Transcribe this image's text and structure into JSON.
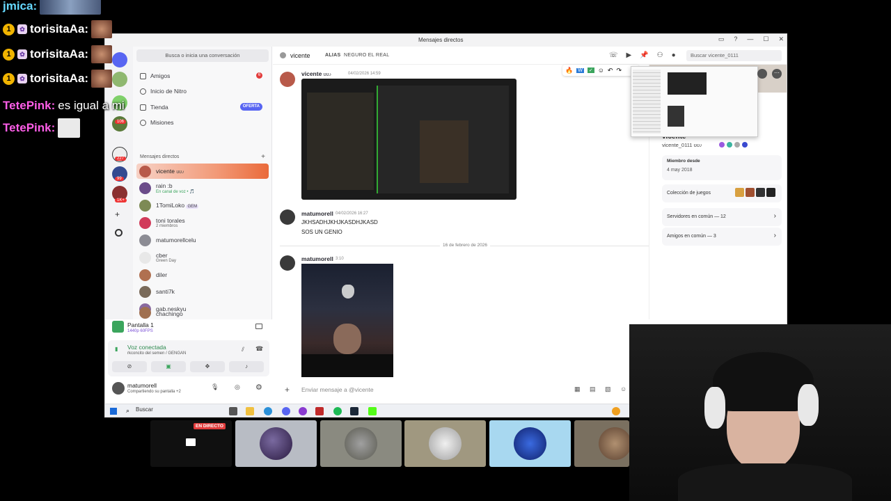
{
  "chat_overlay": [
    {
      "user": "jmica",
      "color": "#66d9ff",
      "text": "",
      "badges": []
    },
    {
      "user": "torisitaAa",
      "color": "#ffffff",
      "text": "",
      "badges": [
        "gold",
        "pink"
      ]
    },
    {
      "user": "torisitaAa",
      "color": "#ffffff",
      "text": "",
      "badges": [
        "gold",
        "pink"
      ]
    },
    {
      "user": "torisitaAa",
      "color": "#ffffff",
      "text": "",
      "badges": [
        "gold",
        "pink"
      ]
    },
    {
      "user": "TetePink",
      "color": "#ff5ee8",
      "text": "es igual a mi",
      "badges": []
    },
    {
      "user": "TetePink",
      "color": "#ff5ee8",
      "text": "",
      "badges": []
    }
  ],
  "window": {
    "title": "Mensajes directos"
  },
  "rail": {
    "badges": [
      "106",
      "227",
      "99",
      "1K+"
    ]
  },
  "sidebar": {
    "search_placeholder": "Busca o inicia una conversación",
    "nav": [
      {
        "label": "Amigos",
        "badge": "6"
      },
      {
        "label": "Inicio de Nitro",
        "badge": ""
      },
      {
        "label": "Tienda",
        "badge": "OFERTA"
      },
      {
        "label": "Misiones",
        "badge": ""
      }
    ],
    "dm_header": "Mensajes directos",
    "dms": [
      {
        "name": "vicente",
        "tag": "ʊʊ♪",
        "sub": "",
        "color": "#b85a4a",
        "active": true
      },
      {
        "name": "rain :b",
        "tag": "",
        "sub": "En canal de voz • 🎵",
        "color": "#6b4c8a"
      },
      {
        "name": "1TomiLoko",
        "tag": "GEM",
        "sub": "",
        "color": "#7d8a55"
      },
      {
        "name": "toni torales",
        "tag": "",
        "sub": "2 miembros",
        "color": "#d13b5a"
      },
      {
        "name": "matumorellcelu",
        "tag": "",
        "sub": "",
        "color": "#8c8c94"
      },
      {
        "name": "cber",
        "tag": "",
        "sub": "Green Day",
        "color": "#e8e8e8"
      },
      {
        "name": "diler",
        "tag": "",
        "sub": "",
        "color": "#b07050"
      },
      {
        "name": "santi7k",
        "tag": "",
        "sub": "",
        "color": "#7a6a5a"
      },
      {
        "name": "gab.neskyu",
        "tag": "",
        "sub": "",
        "color": "#8a6aa0"
      },
      {
        "name": "chachingo",
        "tag": "",
        "sub": "",
        "color": "#a07050"
      }
    ],
    "screen": {
      "title": "Pantalla 1",
      "sub": "1440p 60FPS"
    },
    "voice": {
      "status": "Voz conectada",
      "channel": "rkconcito del semen / GENGAN"
    },
    "user": {
      "name": "matumorell",
      "status": "Compartiendo su pantalla +2"
    }
  },
  "chat": {
    "header_name": "vicente",
    "tabs": [
      "ALIAS",
      "NEGURO EL REAL"
    ],
    "search_placeholder": "Buscar vicente_0111",
    "messages": [
      {
        "author": "vicente",
        "tag": "ʊʊ♪",
        "time": "04/02/2026 14:59",
        "lines": []
      },
      {
        "author": "matumorell",
        "tag": "",
        "time": "04/02/2026 16:27",
        "lines": [
          "JKHSADHJKHJKASDHJKASD",
          "SOS UN GENIO"
        ]
      },
      {
        "author": "matumorell",
        "tag": "",
        "time": "3:10",
        "lines": []
      }
    ],
    "date_separator": "16 de febrero de 2026",
    "composer_placeholder": "Enviar mensaje a @vicente"
  },
  "profile": {
    "display_name": "vicente",
    "username": "vicente_0111",
    "tag": "ʊʊ♪",
    "member_since_label": "Miembro desde",
    "member_since": "4 may 2018",
    "games_label": "Colección de juegos",
    "servers": "Servidores en común — 12",
    "friends": "Amigos en común — 3"
  },
  "taskbar": {
    "search": "Buscar"
  },
  "stream": {
    "live_label": "EN DIRECTO"
  }
}
